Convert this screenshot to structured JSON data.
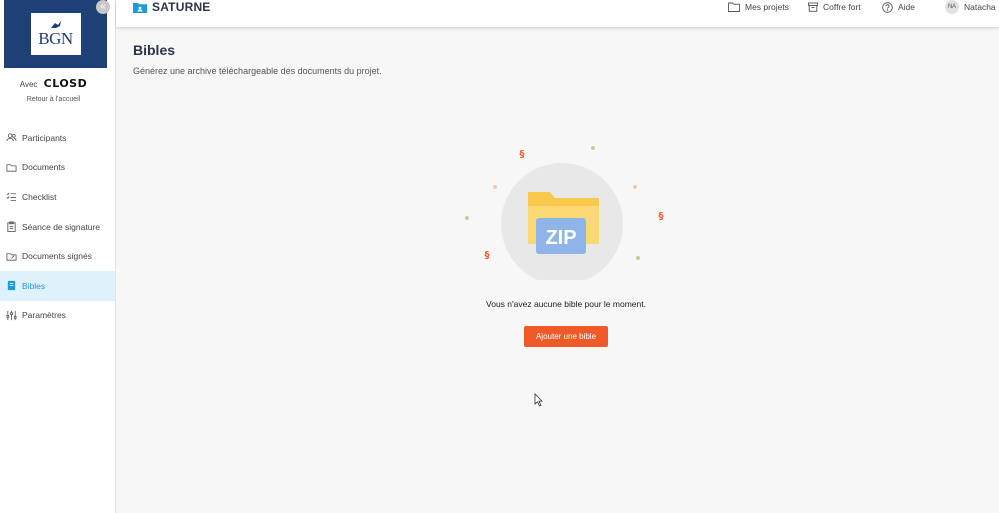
{
  "sidebar": {
    "logo_text": "BGN",
    "collapse_glyph": "«",
    "avec_label": "Avec",
    "closd_brand": "CLOSD",
    "back_link": "Retour à l'accueil",
    "items": [
      {
        "label": "Participants",
        "icon": "users-icon"
      },
      {
        "label": "Documents",
        "icon": "folder-icon"
      },
      {
        "label": "Checklist",
        "icon": "checklist-icon"
      },
      {
        "label": "Séance de signature",
        "icon": "clipboard-icon"
      },
      {
        "label": "Documents signés",
        "icon": "signed-doc-icon"
      },
      {
        "label": "Bibles",
        "icon": "bible-icon",
        "active": true
      },
      {
        "label": "Paramètres",
        "icon": "sliders-icon"
      }
    ]
  },
  "header": {
    "project_title": "SATURNE",
    "links": {
      "projects": "Mes projets",
      "vault": "Coffre fort",
      "help": "Aide"
    },
    "user": {
      "initials": "NA",
      "name": "Natacha"
    }
  },
  "main": {
    "title": "Bibles",
    "subtitle": "Générez une archive téléchargeable des documents du projet.",
    "illustration_label": "ZIP",
    "empty_message": "Vous n'avez aucune bible pour le moment.",
    "add_button": "Ajouter une bible"
  },
  "colors": {
    "accent": "#1d9bd7",
    "brand_navy": "#1f3f77",
    "cta": "#f05a28",
    "active_bg": "#dff1fb"
  }
}
